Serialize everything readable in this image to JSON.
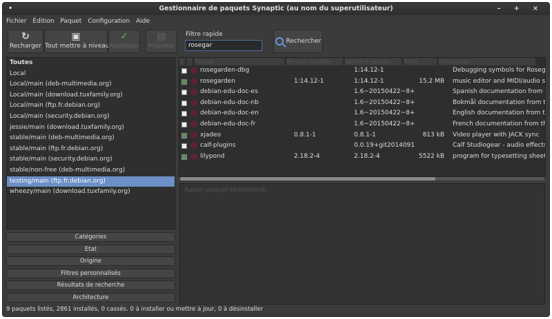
{
  "window": {
    "title": "Gestionnaire de paquets Synaptic  (au nom du superutilisateur)",
    "controls": "– + ×"
  },
  "menu": [
    "Fichier",
    "Édition",
    "Paquet",
    "Configuration",
    "Aide"
  ],
  "toolbar": {
    "reload": "Recharger",
    "upgrade": "Tout mettre à niveau",
    "apply": "Appliquer",
    "properties": "Propriétés",
    "filter_label": "Filtre rapide",
    "filter_value": "rosegar",
    "search": "Rechercher"
  },
  "sources": [
    "Toutes",
    "Local",
    "Local/main (deb-multimedia.org)",
    "Local/main (download.tuxfamily.org)",
    "Local/main (ftp.fr.debian.org)",
    "Local/main (security.debian.org)",
    "jessie/main (download.tuxfamily.org)",
    "stable/main (deb-multimedia.org)",
    "stable/main (ftp.fr.debian.org)",
    "stable/main (security.debian.org)",
    "stable/non-free (deb-multimedia.org)",
    "testing/main (ftp.fr.debian.org)",
    "wheezy/main (download.tuxfamily.org)"
  ],
  "selected_source": "testing/main (ftp.fr.debian.org)",
  "filter_buttons": [
    "Catégories",
    "Etat",
    "Origine",
    "Filtres personnalisés",
    "Résultats de recherche",
    "Architecture"
  ],
  "columns": [
    "S",
    "",
    "Paquet",
    "Version installée",
    "Dernière version",
    "Taille",
    "Description"
  ],
  "packages": [
    {
      "name": "rosegarden-dbg",
      "installed": "",
      "latest": "1:14.12-1",
      "size": "",
      "desc": "Debugging symbols for Rosegarden",
      "is_installed": false
    },
    {
      "name": "rosegarden",
      "installed": "1:14.12-1",
      "latest": "1:14.12-1",
      "size": "15,2 MB",
      "desc": "music editor and MIDI/audio sequencer",
      "is_installed": true
    },
    {
      "name": "debian-edu-doc-es",
      "installed": "",
      "latest": "1.6~20150422~8+",
      "size": "",
      "desc": "Spanish documentation from the",
      "is_installed": false
    },
    {
      "name": "debian-edu-doc-nb",
      "installed": "",
      "latest": "1.6~20150422~8+",
      "size": "",
      "desc": "Bokmål documentation from the",
      "is_installed": false
    },
    {
      "name": "debian-edu-doc-en",
      "installed": "",
      "latest": "1.6~20150422~8+",
      "size": "",
      "desc": "English documentation from the",
      "is_installed": false
    },
    {
      "name": "debian-edu-doc-fr",
      "installed": "",
      "latest": "1.6~20150422~8+",
      "size": "",
      "desc": "French documentation from the",
      "is_installed": false
    },
    {
      "name": "xjadeo",
      "installed": "0.8.1-1",
      "latest": "0.8.1-1",
      "size": "813 kB",
      "desc": "Video player with JACK sync",
      "is_installed": true
    },
    {
      "name": "calf-plugins",
      "installed": "",
      "latest": "0.0.19+git2014091",
      "size": "",
      "desc": "Calf Studiogear - audio effects and",
      "is_installed": false
    },
    {
      "name": "lilypond",
      "installed": "2.18.2-4",
      "latest": "2.18.2-4",
      "size": "5522 kB",
      "desc": "program for typesetting sheet music",
      "is_installed": true
    }
  ],
  "detail_placeholder": "Aucun paquet sélectionné.",
  "status": "9 paquets listés, 2861 installés, 0 cassés. 0 à installer ou mettre à jour, 0 à désinstaller"
}
